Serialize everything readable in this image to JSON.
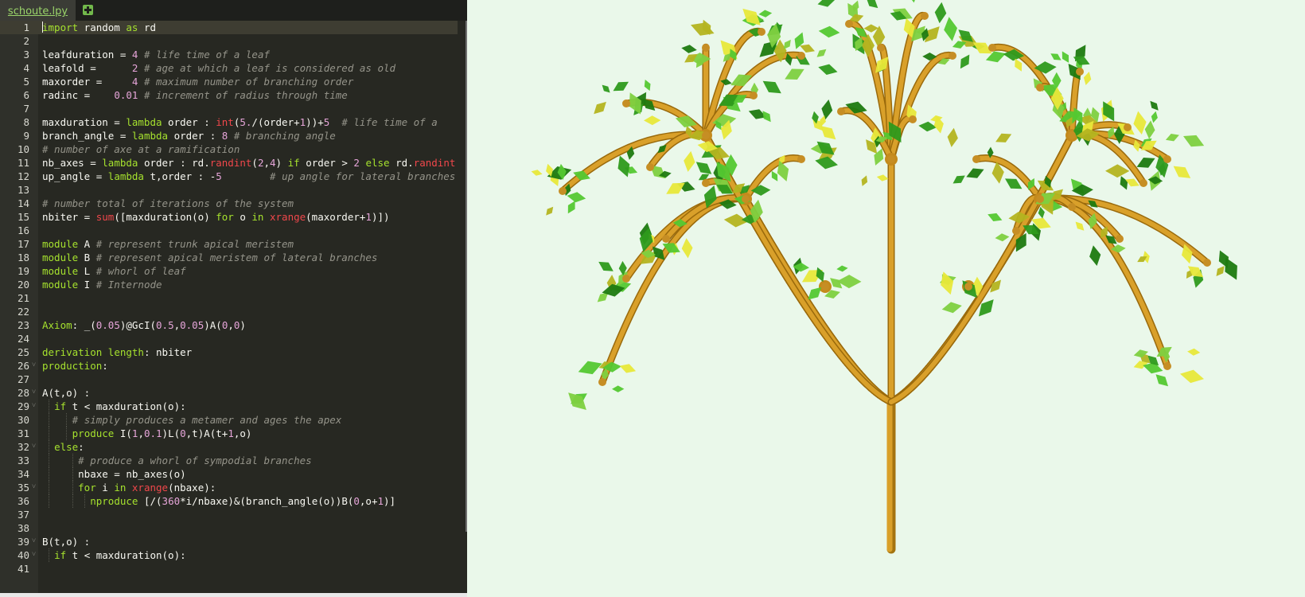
{
  "editor": {
    "tab_label": "schoute.lpy",
    "add_tab_icon": "plus-square-icon",
    "theme": {
      "background": "#272822",
      "keyword": "#a6e22e",
      "number": "#e6a5d9",
      "builtin": "#f0474b",
      "comment": "#95948a"
    },
    "lines": [
      {
        "n": "1",
        "text": "import random as rd"
      },
      {
        "n": "2",
        "text": ""
      },
      {
        "n": "3",
        "text": "leafduration = 4 # life time of a leaf"
      },
      {
        "n": "4",
        "text": "leafold =      2 # age at which a leaf is considered as old"
      },
      {
        "n": "5",
        "text": "maxorder =     4 # maximum number of branching order"
      },
      {
        "n": "6",
        "text": "radinc =    0.01 # increment of radius through time"
      },
      {
        "n": "7",
        "text": ""
      },
      {
        "n": "8",
        "text": "maxduration = lambda order : int(5./(order+1))+5  # life time of a"
      },
      {
        "n": "9",
        "text": "branch_angle = lambda order : 8 # branching angle"
      },
      {
        "n": "10",
        "text": "# number of axe at a ramification"
      },
      {
        "n": "11",
        "text": "nb_axes = lambda order : rd.randint(2,4) if order > 2 else rd.randint"
      },
      {
        "n": "12",
        "text": "up_angle = lambda t,order : -5        # up angle for lateral branches"
      },
      {
        "n": "13",
        "text": ""
      },
      {
        "n": "14",
        "text": "# number total of iterations of the system"
      },
      {
        "n": "15",
        "text": "nbiter = sum([maxduration(o) for o in xrange(maxorder+1)])"
      },
      {
        "n": "16",
        "text": ""
      },
      {
        "n": "17",
        "text": "module A # represent trunk apical meristem"
      },
      {
        "n": "18",
        "text": "module B # represent apical meristem of lateral branches"
      },
      {
        "n": "19",
        "text": "module L # whorl of leaf"
      },
      {
        "n": "20",
        "text": "module I # Internode"
      },
      {
        "n": "21",
        "text": ""
      },
      {
        "n": "22",
        "text": ""
      },
      {
        "n": "23",
        "text": "Axiom: _(0.05)@GcI(0.5,0.05)A(0,0)"
      },
      {
        "n": "24",
        "text": ""
      },
      {
        "n": "25",
        "text": "derivation length: nbiter"
      },
      {
        "n": "26",
        "text": "production:"
      },
      {
        "n": "27",
        "text": ""
      },
      {
        "n": "28",
        "text": "A(t,o) :"
      },
      {
        "n": "29",
        "text": "  if t < maxduration(o):"
      },
      {
        "n": "30",
        "text": "     # simply produces a metamer and ages the apex"
      },
      {
        "n": "31",
        "text": "     produce I(1,0.1)L(0,t)A(t+1,o)"
      },
      {
        "n": "32",
        "text": "  else:"
      },
      {
        "n": "33",
        "text": "      # produce a whorl of sympodial branches"
      },
      {
        "n": "34",
        "text": "      nbaxe = nb_axes(o)"
      },
      {
        "n": "35",
        "text": "      for i in xrange(nbaxe):"
      },
      {
        "n": "36",
        "text": "        nproduce [/(360*i/nbaxe)&(branch_angle(o))B(0,o+1)]"
      },
      {
        "n": "37",
        "text": ""
      },
      {
        "n": "38",
        "text": ""
      },
      {
        "n": "39",
        "text": "B(t,o) :"
      },
      {
        "n": "40",
        "text": "  if t < maxduration(o):"
      },
      {
        "n": "41",
        "text": ""
      }
    ]
  },
  "viewer": {
    "background": "#eaf8ea",
    "branch_color": "#d9a02a",
    "leaf_colors": [
      "#2e9a1c",
      "#54c832",
      "#7ed040",
      "#b4b420",
      "#e8e83a",
      "#1e7a10"
    ]
  }
}
